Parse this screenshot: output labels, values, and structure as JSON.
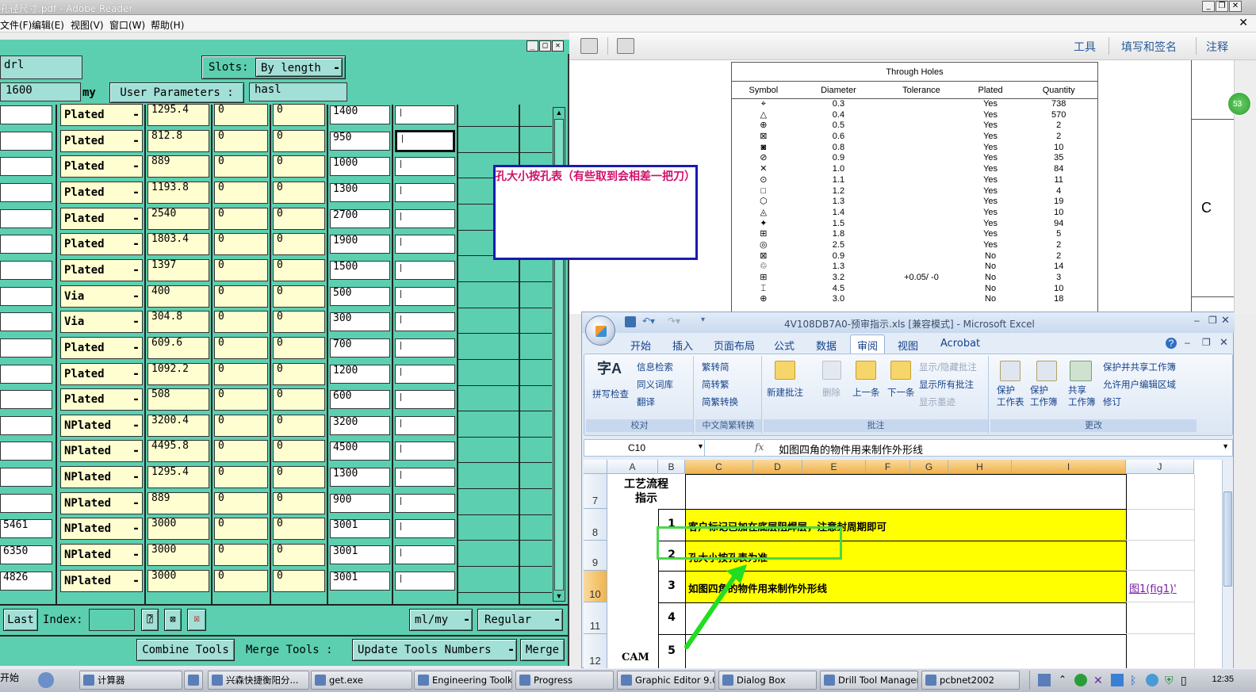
{
  "reader": {
    "title": "孔径尺寸.pdf - Adobe Reader",
    "menu": [
      "文件(F)",
      "编辑(E)",
      "视图(V)",
      "窗口(W)",
      "帮助(H)"
    ],
    "toolbar_links": [
      "工具",
      "填写和签名",
      "注释"
    ],
    "page_badge": "53",
    "side_label": "C"
  },
  "pdf_table": {
    "title": "Through Holes",
    "headers": [
      "Symbol",
      "Diameter",
      "Tolerance",
      "Plated",
      "Quantity"
    ],
    "rows": [
      [
        "⌖",
        "0.3",
        "",
        "Yes",
        "738"
      ],
      [
        "△",
        "0.4",
        "",
        "Yes",
        "570"
      ],
      [
        "⊕",
        "0.5",
        "",
        "Yes",
        "2"
      ],
      [
        "⊠",
        "0.6",
        "",
        "Yes",
        "2"
      ],
      [
        "◙",
        "0.8",
        "",
        "Yes",
        "10"
      ],
      [
        "⊘",
        "0.9",
        "",
        "Yes",
        "35"
      ],
      [
        "✕",
        "1.0",
        "",
        "Yes",
        "84"
      ],
      [
        "⊙",
        "1.1",
        "",
        "Yes",
        "11"
      ],
      [
        "□",
        "1.2",
        "",
        "Yes",
        "4"
      ],
      [
        "⬡",
        "1.3",
        "",
        "Yes",
        "19"
      ],
      [
        "◬",
        "1.4",
        "",
        "Yes",
        "10"
      ],
      [
        "✦",
        "1.5",
        "",
        "Yes",
        "94"
      ],
      [
        "⊞",
        "1.8",
        "",
        "Yes",
        "5"
      ],
      [
        "◎",
        "2.5",
        "",
        "Yes",
        "2"
      ],
      [
        "⊠",
        "0.9",
        "",
        "No",
        "2"
      ],
      [
        "♲",
        "1.3",
        "",
        "No",
        "14"
      ],
      [
        "⊞",
        "3.2",
        "+0.05/ -0",
        "No",
        "3"
      ],
      [
        "⌶",
        "4.5",
        "",
        "No",
        "10"
      ],
      [
        "⊕",
        "3.0",
        "",
        "No",
        "18"
      ]
    ]
  },
  "note": {
    "text": "孔大小按孔表（有些取到会相差一把刀）"
  },
  "dtm": {
    "field_drl": "drl",
    "slots_label": "Slots:",
    "slots_value": "By length",
    "field_1600": "1600",
    "my_label": "my",
    "user_params_label": "User Parameters :",
    "field_hasl": "hasl",
    "rows": [
      {
        "left": "",
        "type": "Plated",
        "c1": "1295.4",
        "c2": "0",
        "c3": "0",
        "c4": "1400"
      },
      {
        "left": "",
        "type": "Plated",
        "c1": "812.8",
        "c2": "0",
        "c3": "0",
        "c4": "950"
      },
      {
        "left": "",
        "type": "Plated",
        "c1": "889",
        "c2": "0",
        "c3": "0",
        "c4": "1000"
      },
      {
        "left": "",
        "type": "Plated",
        "c1": "1193.8",
        "c2": "0",
        "c3": "0",
        "c4": "1300"
      },
      {
        "left": "",
        "type": "Plated",
        "c1": "2540",
        "c2": "0",
        "c3": "0",
        "c4": "2700"
      },
      {
        "left": "",
        "type": "Plated",
        "c1": "1803.4",
        "c2": "0",
        "c3": "0",
        "c4": "1900"
      },
      {
        "left": "",
        "type": "Plated",
        "c1": "1397",
        "c2": "0",
        "c3": "0",
        "c4": "1500"
      },
      {
        "left": "",
        "type": "Via",
        "c1": "400",
        "c2": "0",
        "c3": "0",
        "c4": "500"
      },
      {
        "left": "",
        "type": "Via",
        "c1": "304.8",
        "c2": "0",
        "c3": "0",
        "c4": "300"
      },
      {
        "left": "",
        "type": "Plated",
        "c1": "609.6",
        "c2": "0",
        "c3": "0",
        "c4": "700"
      },
      {
        "left": "",
        "type": "Plated",
        "c1": "1092.2",
        "c2": "0",
        "c3": "0",
        "c4": "1200"
      },
      {
        "left": "",
        "type": "Plated",
        "c1": "508",
        "c2": "0",
        "c3": "0",
        "c4": "600"
      },
      {
        "left": "",
        "type": "NPlated",
        "c1": "3200.4",
        "c2": "0",
        "c3": "0",
        "c4": "3200"
      },
      {
        "left": "",
        "type": "NPlated",
        "c1": "4495.8",
        "c2": "0",
        "c3": "0",
        "c4": "4500"
      },
      {
        "left": "",
        "type": "NPlated",
        "c1": "1295.4",
        "c2": "0",
        "c3": "0",
        "c4": "1300"
      },
      {
        "left": "",
        "type": "NPlated",
        "c1": "889",
        "c2": "0",
        "c3": "0",
        "c4": "900"
      },
      {
        "left": "5461",
        "type": "NPlated",
        "c1": "3000",
        "c2": "0",
        "c3": "0",
        "c4": "3001"
      },
      {
        "left": "6350",
        "type": "NPlated",
        "c1": "3000",
        "c2": "0",
        "c3": "0",
        "c4": "3001"
      },
      {
        "left": "4826",
        "type": "NPlated",
        "c1": "3000",
        "c2": "0",
        "c3": "0",
        "c4": "3001"
      }
    ],
    "last_button": "Last",
    "index_label": "Index:",
    "units_menu": "ml/my",
    "mode_menu": "Regular",
    "combine_button": "Combine Tools",
    "merge_label": "Merge Tools :",
    "update_menu": "Update Tools Numbers",
    "merge_button": "Merge"
  },
  "excel": {
    "title": "4V108DB7A0-预审指示.xls  [兼容模式] - Microsoft Excel",
    "tabs": [
      "开始",
      "插入",
      "页面布局",
      "公式",
      "数据",
      "审阅",
      "视图",
      "Acrobat"
    ],
    "active_tab": "审阅",
    "ribbon": {
      "spell": "拼写检查",
      "info_search": "信息检索",
      "thesaurus": "同义词库",
      "translate": "翻译",
      "group_proof": "校对",
      "to_simplified": "繁转简",
      "to_traditional": "简转繁",
      "convert": "简繁转换",
      "group_chinese": "中文简繁转换",
      "new_comment": "新建批注",
      "delete": "删除",
      "prev": "上一条",
      "next": "下一条",
      "show_hide": "显示/隐藏批注",
      "show_all": "显示所有批注",
      "show_ink": "显示墨迹",
      "group_comments": "批注",
      "protect_sheet": "保护\n工作表",
      "protect_workbook": "保护\n工作簿",
      "share_workbook": "共享\n工作簿",
      "protect_share": "保护并共享工作簿",
      "allow_edit": "允许用户编辑区域",
      "track": "修订",
      "group_changes": "更改"
    },
    "name_box": "C10",
    "fx": "fx",
    "formula": "如图四角的物件用来制作外形线",
    "columns": [
      "A",
      "B",
      "C",
      "D",
      "E",
      "F",
      "G",
      "H",
      "I",
      "J"
    ],
    "rows": [
      "7",
      "8",
      "9",
      "10",
      "11",
      "12"
    ],
    "header_cell": "工艺流程\n指示",
    "items": [
      {
        "num": "1",
        "text": "客户标记已加在底层阻焊层，注意封周期即可"
      },
      {
        "num": "2",
        "text": "孔大小按孔表为准"
      },
      {
        "num": "3",
        "text": "如图四角的物件用来制作外形线"
      },
      {
        "num": "4",
        "text": ""
      },
      {
        "num": "5",
        "text": ""
      }
    ],
    "link": "图1(fig1)'",
    "cam_label": "CAM"
  },
  "taskbar": {
    "start": "开始",
    "items": [
      "计算器",
      "",
      "兴森快捷衡阳分...",
      "get.exe",
      "Engineering Toolki...",
      "Progress",
      "Graphic Editor 9.0...",
      "Dialog Box",
      "Drill Tool Manager",
      "pcbnet2002"
    ],
    "clock": "12:35"
  },
  "colors": {
    "dtm_bg": "#5ccfb0",
    "dtm_field": "#fefed0",
    "excel_highlight": "#ffff00",
    "note_border": "#1a1ab0",
    "note_text": "#d0106a",
    "arrow": "#22dd22"
  }
}
